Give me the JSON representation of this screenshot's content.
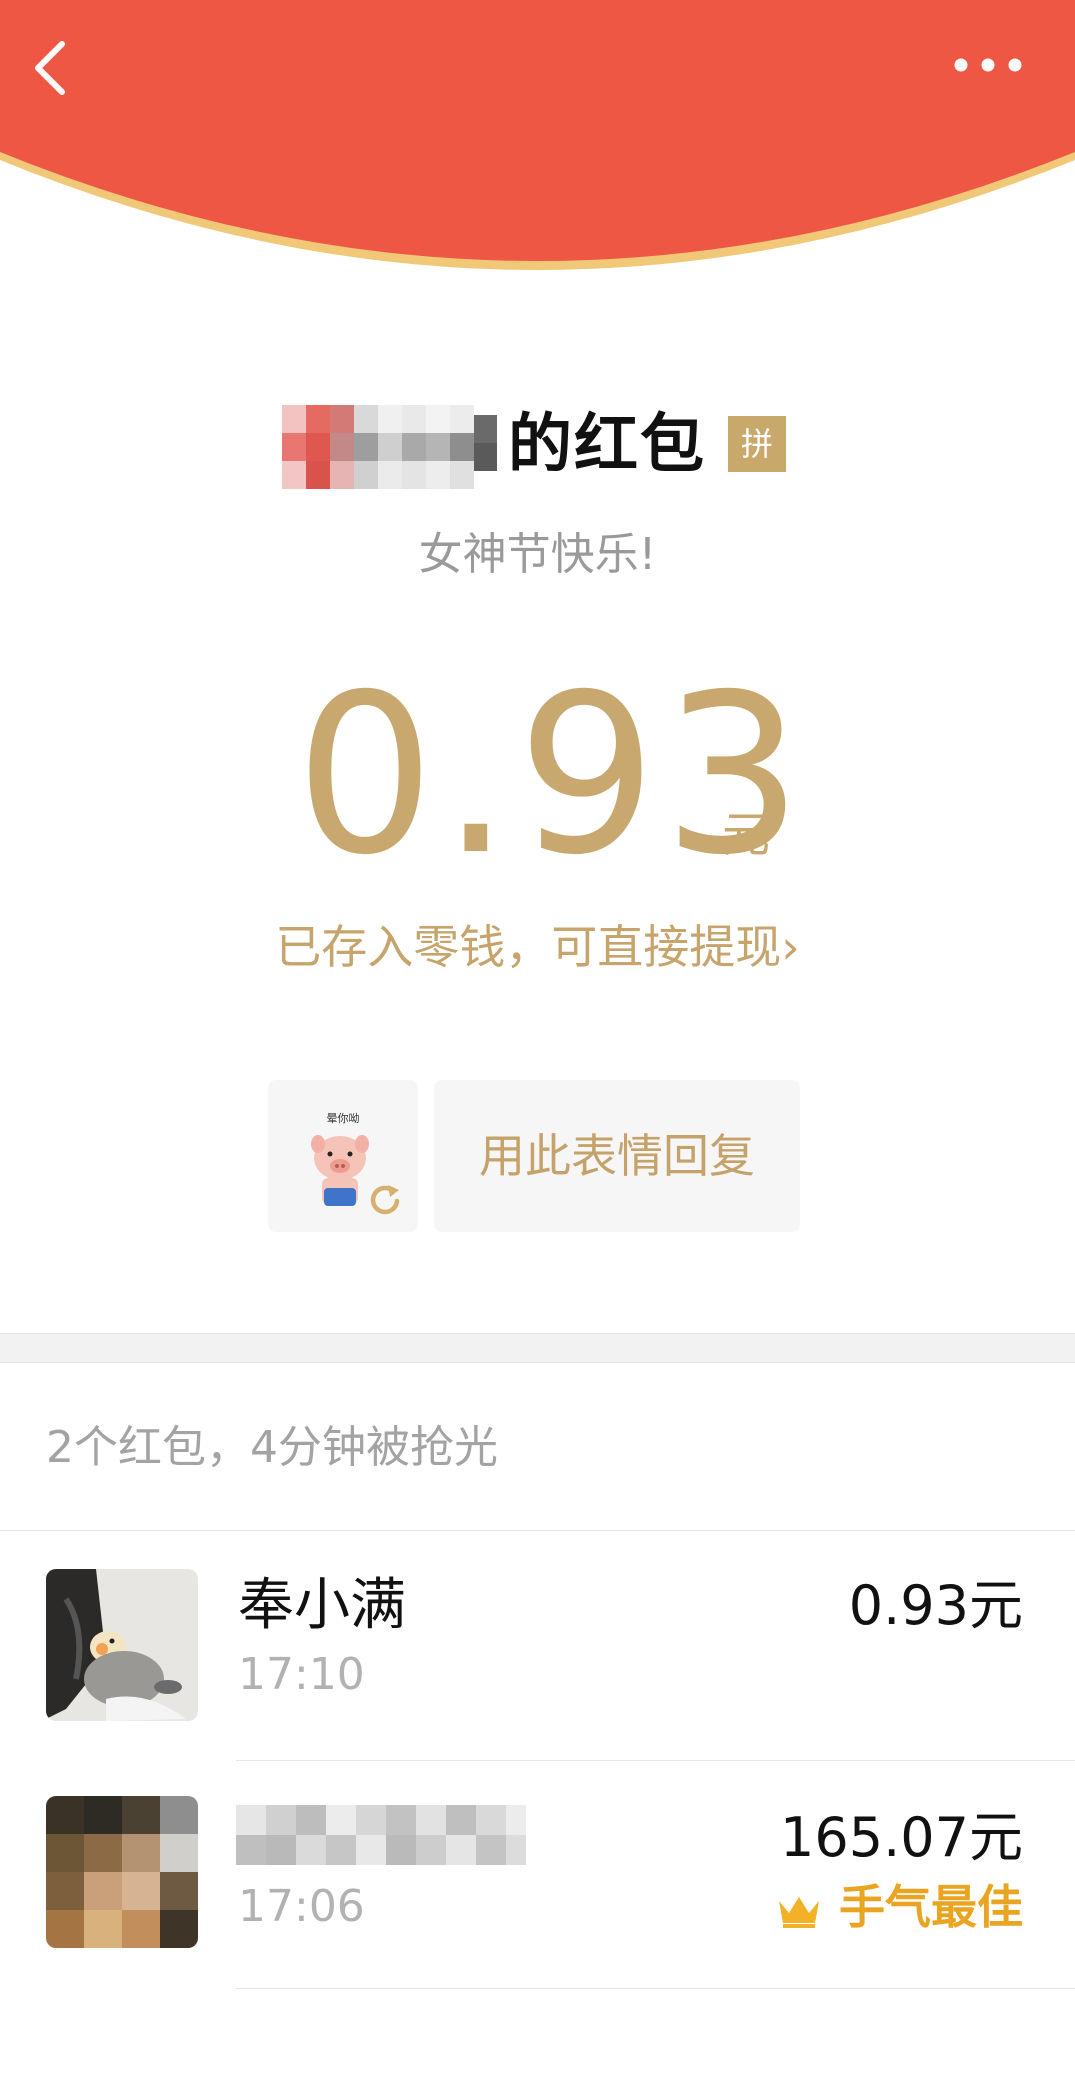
{
  "header": {
    "background_color": "#ef5745",
    "rim_color": "#f0c878",
    "back_icon": "chevron-left-icon",
    "more_icon": "more-horizontal-icon"
  },
  "packet": {
    "sender_title_suffix": "的红包",
    "pin_badge": "拼",
    "blessing": "女神节快乐!",
    "amount": "0.93",
    "amount_unit": "元",
    "saved_notice": "已存入零钱，可直接提现",
    "saved_arrow": "›",
    "reply_label": "用此表情回复",
    "sticker_caption": "晕你呦"
  },
  "records": {
    "summary": "2个红包，4分钟被抢光",
    "items": [
      {
        "name": "奉小满",
        "time": "17:10",
        "amount": "0.93元"
      },
      {
        "name": "",
        "time": "17:06",
        "amount": "165.07元",
        "badge": "手气最佳"
      }
    ]
  },
  "colors": {
    "gold": "#c9a870",
    "best_orange": "#e9a421"
  }
}
